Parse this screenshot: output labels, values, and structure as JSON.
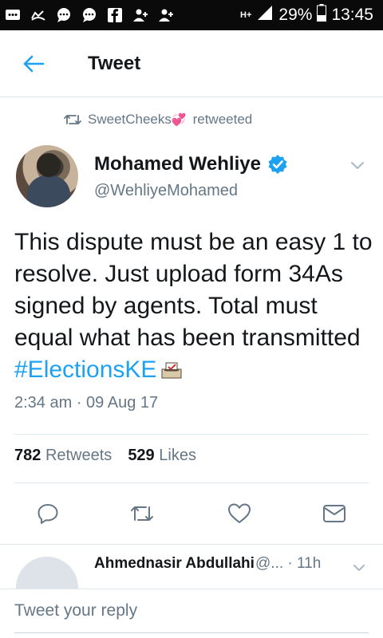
{
  "status_bar": {
    "battery": "29%",
    "time": "13:45",
    "network": "H+",
    "icons": [
      "messages-icon",
      "missed-call-icon",
      "chat-icon",
      "chat-icon",
      "facebook-icon",
      "person-add-icon",
      "person-add-icon"
    ]
  },
  "header": {
    "title": "Tweet"
  },
  "retweet": {
    "user": "SweetCheeks",
    "emoji": "💞",
    "label": "retweeted"
  },
  "tweet": {
    "author_name": "Mohamed Wehliye",
    "author_handle": "@WehliyeMohamed",
    "text": "This dispute must be an easy 1 to resolve. Just upload form 34As signed by agents. Total must equal what has been transmitted ",
    "hashtag": "#ElectionsKE",
    "emoji_icon": "ballot-box-icon",
    "timestamp": "2:34 am · 09 Aug 17",
    "retweets_count": "782",
    "retweets_label": "Retweets",
    "likes_count": "529",
    "likes_label": "Likes"
  },
  "reply": {
    "author_name": "Ahmednasir Abdullahi",
    "meta": "@... · 11h"
  },
  "compose": {
    "placeholder": "Tweet your reply"
  },
  "colors": {
    "accent": "#1da1f2",
    "text": "#14171a",
    "muted": "#657786",
    "heart": "#e0245e"
  }
}
